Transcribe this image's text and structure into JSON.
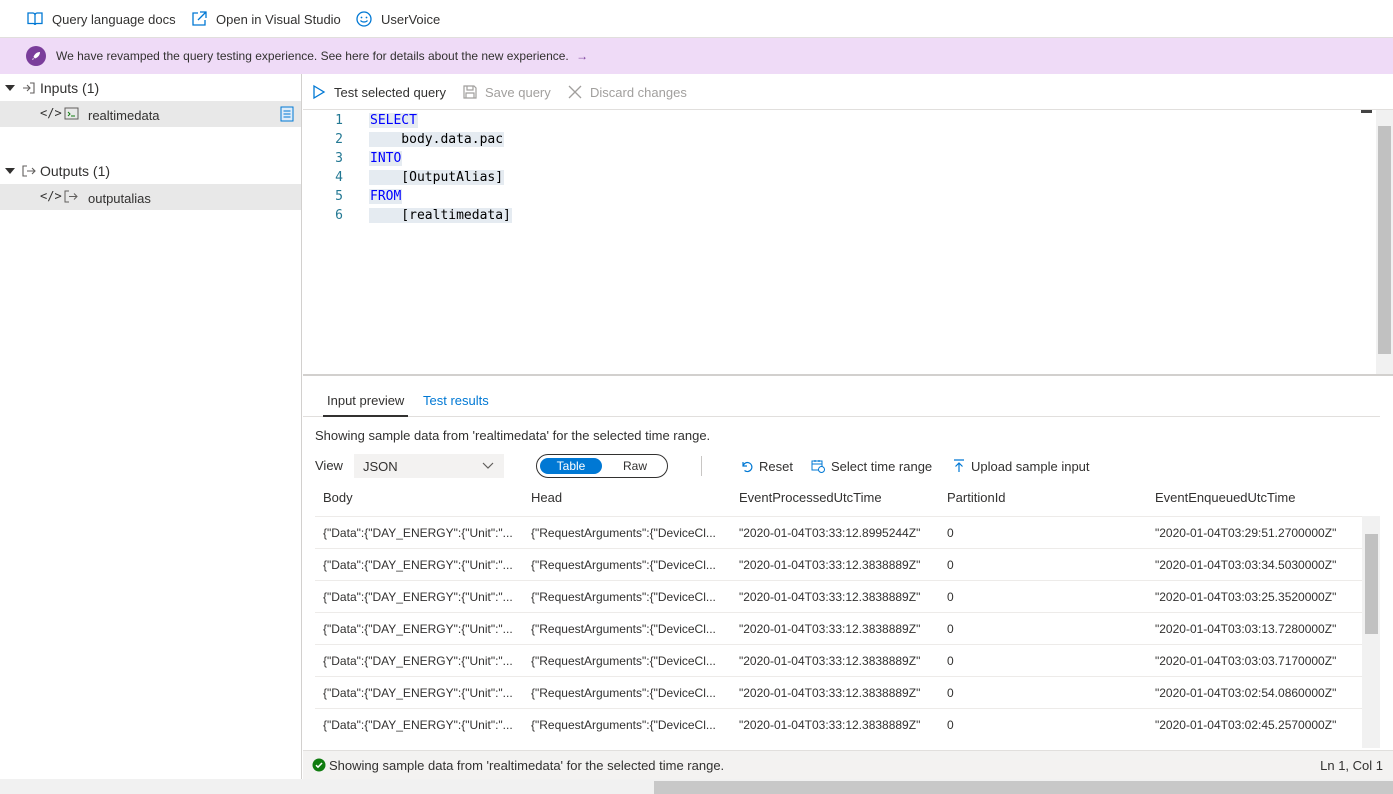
{
  "topbar": {
    "docs_label": "Query language docs",
    "vs_label": "Open in Visual Studio",
    "uservoice_label": "UserVoice"
  },
  "banner": {
    "message": "We have revamped the query testing experience. See here for details about the new experience.",
    "arrow": "→"
  },
  "tree": {
    "inputs_label": "Inputs (1)",
    "input_item": "realtimedata",
    "outputs_label": "Outputs (1)",
    "output_item": "outputalias"
  },
  "editor_toolbar": {
    "test_label": "Test selected query",
    "save_label": "Save query",
    "discard_label": "Discard changes"
  },
  "code": {
    "lines": [
      {
        "num": "1",
        "text": "SELECT"
      },
      {
        "num": "2",
        "text": "    body.data.pac"
      },
      {
        "num": "3",
        "text": "INTO"
      },
      {
        "num": "4",
        "text": "    [OutputAlias]"
      },
      {
        "num": "5",
        "text": "FROM"
      },
      {
        "num": "6",
        "text": "    [realtimedata]"
      }
    ]
  },
  "tabs": {
    "input_preview": "Input preview",
    "test_results": "Test results"
  },
  "preview": {
    "message": "Showing sample data from 'realtimedata' for the selected time range.",
    "view_label": "View",
    "view_value": "JSON",
    "toggle_table": "Table",
    "toggle_raw": "Raw",
    "reset_label": "Reset",
    "time_range_label": "Select time range",
    "upload_label": "Upload sample input"
  },
  "table": {
    "headers": [
      "Body",
      "Head",
      "EventProcessedUtcTime",
      "PartitionId",
      "EventEnqueuedUtcTime"
    ],
    "rows": [
      [
        "{\"Data\":{\"DAY_ENERGY\":{\"Unit\":\"...",
        "{\"RequestArguments\":{\"DeviceCl...",
        "\"2020-01-04T03:33:12.8995244Z\"",
        "0",
        "\"2020-01-04T03:29:51.2700000Z\""
      ],
      [
        "{\"Data\":{\"DAY_ENERGY\":{\"Unit\":\"...",
        "{\"RequestArguments\":{\"DeviceCl...",
        "\"2020-01-04T03:33:12.3838889Z\"",
        "0",
        "\"2020-01-04T03:03:34.5030000Z\""
      ],
      [
        "{\"Data\":{\"DAY_ENERGY\":{\"Unit\":\"...",
        "{\"RequestArguments\":{\"DeviceCl...",
        "\"2020-01-04T03:33:12.3838889Z\"",
        "0",
        "\"2020-01-04T03:03:25.3520000Z\""
      ],
      [
        "{\"Data\":{\"DAY_ENERGY\":{\"Unit\":\"...",
        "{\"RequestArguments\":{\"DeviceCl...",
        "\"2020-01-04T03:33:12.3838889Z\"",
        "0",
        "\"2020-01-04T03:03:13.7280000Z\""
      ],
      [
        "{\"Data\":{\"DAY_ENERGY\":{\"Unit\":\"...",
        "{\"RequestArguments\":{\"DeviceCl...",
        "\"2020-01-04T03:33:12.3838889Z\"",
        "0",
        "\"2020-01-04T03:03:03.7170000Z\""
      ],
      [
        "{\"Data\":{\"DAY_ENERGY\":{\"Unit\":\"...",
        "{\"RequestArguments\":{\"DeviceCl...",
        "\"2020-01-04T03:33:12.3838889Z\"",
        "0",
        "\"2020-01-04T03:02:54.0860000Z\""
      ],
      [
        "{\"Data\":{\"DAY_ENERGY\":{\"Unit\":\"...",
        "{\"RequestArguments\":{\"DeviceCl...",
        "\"2020-01-04T03:33:12.3838889Z\"",
        "0",
        "\"2020-01-04T03:02:45.2570000Z\""
      ]
    ]
  },
  "status": {
    "message": "Showing sample data from 'realtimedata' for the selected time range.",
    "position": "Ln 1, Col 1"
  },
  "colors": {
    "accent": "#0078d4",
    "banner_bg": "#efdbf7",
    "success": "#107c10"
  }
}
